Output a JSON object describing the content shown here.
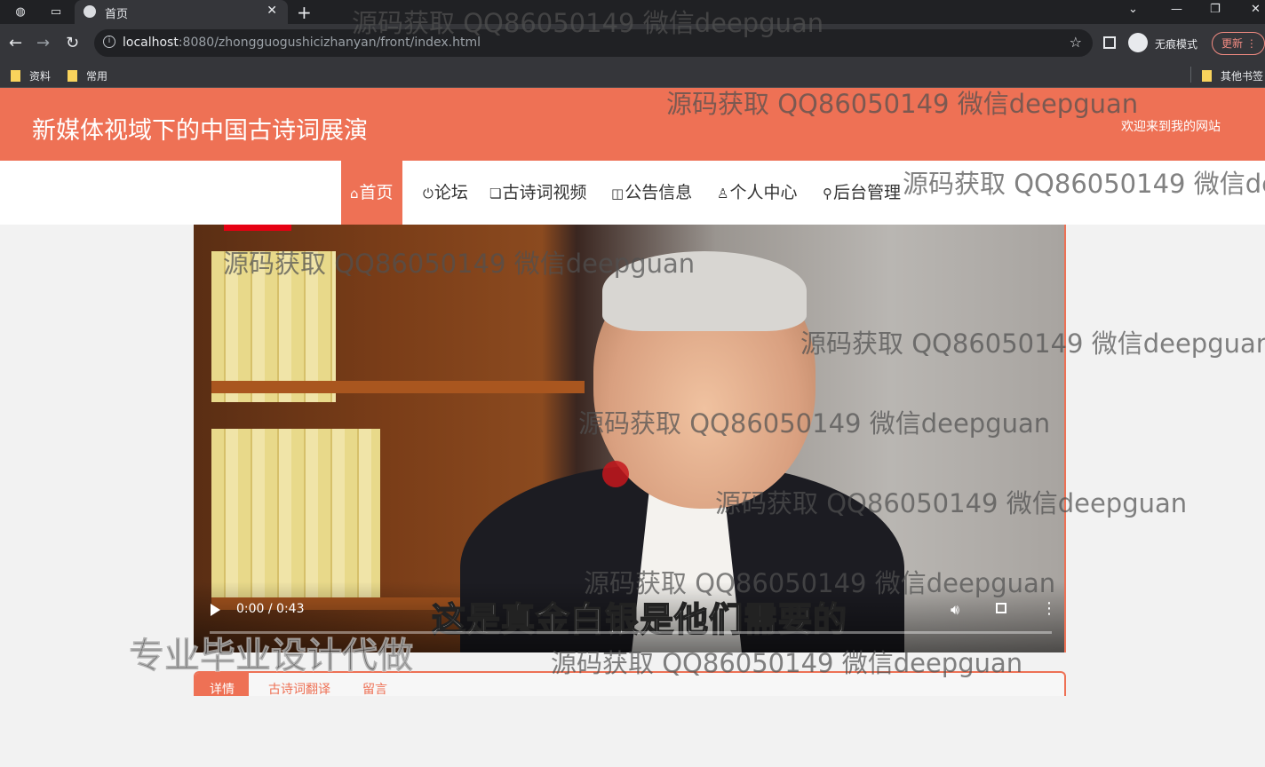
{
  "browser": {
    "tab_title": "首页",
    "url_host": "localhost",
    "url_rest": ":8080/zhongguogushicizhanyan/front/index.html",
    "incognito_label": "无痕模式",
    "update_label": "更新",
    "bookmarks": [
      "资料",
      "常用",
      "其他书签"
    ]
  },
  "site": {
    "title": "新媒体视域下的中国古诗词展演",
    "welcome": "欢迎来到我的网站",
    "accent_color": "#ee7155",
    "nav": [
      {
        "icon": "⌂",
        "label": "首页"
      },
      {
        "icon": "⏻",
        "label": "论坛"
      },
      {
        "icon": "❏",
        "label": "古诗词视频"
      },
      {
        "icon": "◫",
        "label": "公告信息"
      },
      {
        "icon": "♙",
        "label": "个人中心"
      },
      {
        "icon": "⚲",
        "label": "后台管理"
      }
    ]
  },
  "video": {
    "time": "0:00 / 0:43",
    "subtitle": "这是真金白银是他们需要的",
    "progress": 0
  },
  "detail_tabs": [
    "详情",
    "古诗词翻译",
    "留言"
  ],
  "overlay": {
    "promo": "专业毕业设计代做",
    "watermark": "源码获取 QQ86050149 微信deepguan"
  }
}
